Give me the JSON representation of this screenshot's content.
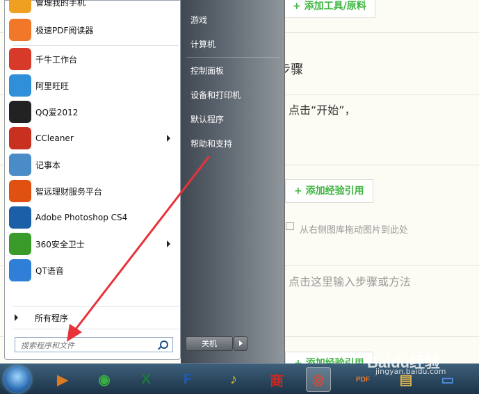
{
  "background": {
    "add_tool_button": "+ 添加工具/原料",
    "method_heading": "方法/步骤",
    "step1_text": "点击“开始”，",
    "add_citation_button": "+ 添加经验引用",
    "image_hint": "从右侧图库拖动图片到此处",
    "step_placeholder": "点击这里输入步骤或方法",
    "add_citation_button_2": "+ 添加经验引用"
  },
  "start_menu": {
    "programs": [
      {
        "label": "管理我的手机",
        "icon": "phone-manager-icon",
        "color": "#f0a020"
      },
      {
        "label": "极速PDF阅读器",
        "icon": "pdf-reader-icon",
        "color": "#f07828"
      },
      {
        "label": "千牛工作台",
        "icon": "qianniu-icon",
        "color": "#d83a2a"
      },
      {
        "label": "阿里旺旺",
        "icon": "aliwangwang-icon",
        "color": "#2f8fd8"
      },
      {
        "label": "QQ爱2012",
        "icon": "qq-icon",
        "color": "#222222"
      },
      {
        "label": "CCleaner",
        "icon": "ccleaner-icon",
        "color": "#c83020",
        "submenu": true
      },
      {
        "label": "记事本",
        "icon": "notepad-icon",
        "color": "#4a8cc8"
      },
      {
        "label": "智远理财服务平台",
        "icon": "finance-icon",
        "color": "#e05010"
      },
      {
        "label": "Adobe Photoshop CS4",
        "icon": "photoshop-icon",
        "color": "#1a5fa8"
      },
      {
        "label": "360安全卫士",
        "icon": "360-safe-icon",
        "color": "#3a9a2a",
        "submenu": true
      },
      {
        "label": "QT语音",
        "icon": "qt-voice-icon",
        "color": "#2f7fd8"
      }
    ],
    "all_programs": "所有程序",
    "search_placeholder": "搜索程序和文件",
    "right_items": [
      "游戏",
      "计算机",
      "控制面板",
      "设备和打印机",
      "默认程序",
      "帮助和支持"
    ],
    "shutdown_label": "关机"
  },
  "taskbar": {
    "items": [
      {
        "name": "media-player-icon",
        "glyph": "▶",
        "color": "#e07a20"
      },
      {
        "name": "phone-manager-icon",
        "glyph": "◉",
        "color": "#3ab040"
      },
      {
        "name": "excel-icon",
        "glyph": "X",
        "color": "#1e7a3a"
      },
      {
        "name": "flashget-icon",
        "glyph": "F",
        "color": "#1e5ab8"
      },
      {
        "name": "qq-music-icon",
        "glyph": "♪",
        "color": "#e0c020"
      },
      {
        "name": "shop-icon",
        "glyph": "商",
        "color": "#d02820"
      },
      {
        "name": "chrome-icon",
        "glyph": "◎",
        "color": "#d84a30",
        "active": true
      },
      {
        "name": "pdf-reader-icon",
        "glyph": "PDF",
        "color": "#f07828"
      },
      {
        "name": "file-explorer-icon",
        "glyph": "▤",
        "color": "#d8b050"
      },
      {
        "name": "desktop-icon",
        "glyph": "▭",
        "color": "#4a8cd8"
      }
    ]
  },
  "watermark": {
    "logo": "Baidu经验",
    "url": "jingyan.baidu.com"
  }
}
